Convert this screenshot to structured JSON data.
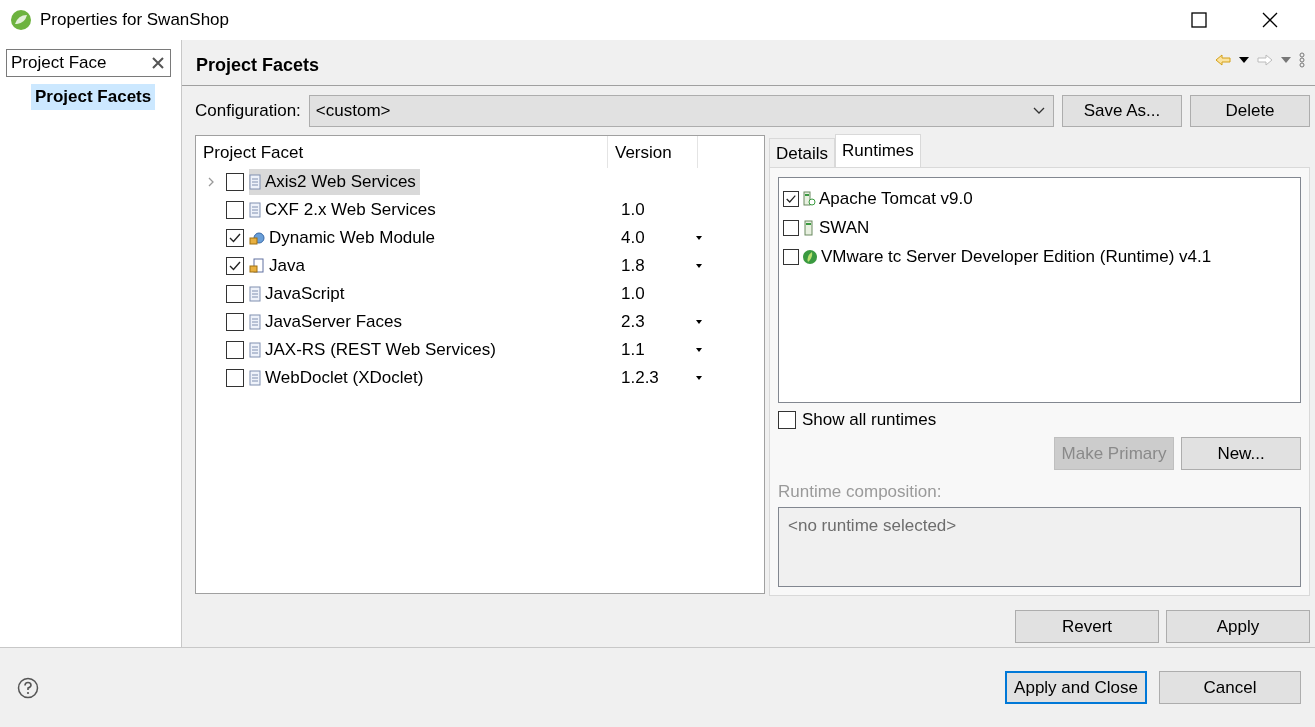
{
  "window": {
    "title": "Properties for SwanShop"
  },
  "sidebar": {
    "filter": {
      "value": "Project Face"
    },
    "items": [
      {
        "label": "Project Facets",
        "selected": true
      }
    ]
  },
  "page": {
    "title": "Project Facets"
  },
  "configuration": {
    "label": "Configuration:",
    "value": "<custom>",
    "buttons": [
      "Save As...",
      "Delete"
    ]
  },
  "facets": {
    "columns": [
      "Project Facet",
      "Version"
    ],
    "rows": [
      {
        "name": "Axis2 Web Services",
        "version": "",
        "checked": false,
        "selected": true,
        "expandable": true,
        "dropdown": false,
        "kind": "document"
      },
      {
        "name": "CXF 2.x Web Services",
        "version": "1.0",
        "checked": false,
        "selected": false,
        "expandable": false,
        "dropdown": false,
        "kind": "document"
      },
      {
        "name": "Dynamic Web Module",
        "version": "4.0",
        "checked": true,
        "selected": false,
        "expandable": false,
        "dropdown": true,
        "kind": "web"
      },
      {
        "name": "Java",
        "version": "1.8",
        "checked": true,
        "selected": false,
        "expandable": false,
        "dropdown": true,
        "kind": "java"
      },
      {
        "name": "JavaScript",
        "version": "1.0",
        "checked": false,
        "selected": false,
        "expandable": false,
        "dropdown": false,
        "kind": "document"
      },
      {
        "name": "JavaServer Faces",
        "version": "2.3",
        "checked": false,
        "selected": false,
        "expandable": false,
        "dropdown": true,
        "kind": "document"
      },
      {
        "name": "JAX-RS (REST Web Services)",
        "version": "1.1",
        "checked": false,
        "selected": false,
        "expandable": false,
        "dropdown": true,
        "kind": "document"
      },
      {
        "name": "WebDoclet (XDoclet)",
        "version": "1.2.3",
        "checked": false,
        "selected": false,
        "expandable": false,
        "dropdown": true,
        "kind": "document"
      }
    ]
  },
  "tabs": [
    {
      "label": "Details",
      "selected": false
    },
    {
      "label": "Runtimes",
      "selected": true
    }
  ],
  "runtimes": [
    {
      "name": "Apache Tomcat v9.0",
      "checked": true,
      "kind": "tomcat"
    },
    {
      "name": "SWAN",
      "checked": false,
      "kind": "server"
    },
    {
      "name": "VMware tc Server Developer Edition (Runtime) v4.1",
      "checked": false,
      "kind": "leaf"
    }
  ],
  "show_all_runtimes": {
    "label": "Show all runtimes",
    "checked": false
  },
  "runtime_buttons": [
    {
      "label": "Make Primary",
      "disabled": true
    },
    {
      "label": "New...",
      "disabled": false
    }
  ],
  "runtime_composition": {
    "label": "Runtime composition:",
    "value": "<no runtime selected>"
  },
  "page_buttons": [
    "Revert",
    "Apply"
  ],
  "dialog_buttons": [
    {
      "label": "Apply and Close",
      "default": true
    },
    {
      "label": "Cancel",
      "default": false
    }
  ]
}
